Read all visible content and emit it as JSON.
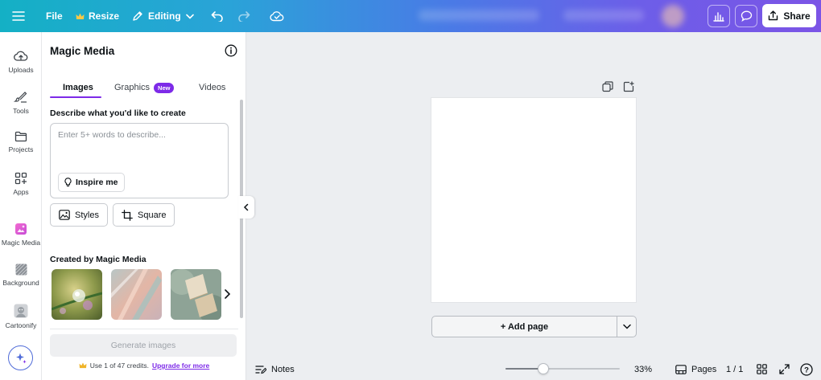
{
  "topbar": {
    "file_label": "File",
    "resize_label": "Resize",
    "editing_label": "Editing",
    "share_label": "Share",
    "icons": [
      "menu-icon",
      "crown-icon",
      "pencil-icon",
      "chevron-down-icon",
      "undo-icon",
      "redo-icon",
      "cloud-check-icon",
      "chart-icon",
      "comment-icon",
      "share-icon"
    ]
  },
  "rail": {
    "items": [
      {
        "label": "Uploads",
        "icon": "upload-cloud-icon"
      },
      {
        "label": "Tools",
        "icon": "tools-icon"
      },
      {
        "label": "Projects",
        "icon": "folder-icon"
      },
      {
        "label": "Apps",
        "icon": "apps-grid-icon"
      },
      {
        "label": "Magic Media",
        "icon": "magic-media-icon"
      },
      {
        "label": "Background",
        "icon": "background-pattern-icon"
      },
      {
        "label": "Cartoonify",
        "icon": "cartoonify-icon"
      }
    ],
    "fab_icon": "sparkle-icon"
  },
  "panel": {
    "title": "Magic Media",
    "tabs": [
      {
        "label": "Images",
        "active": true
      },
      {
        "label": "Graphics",
        "badge": "New"
      },
      {
        "label": "Videos"
      }
    ],
    "describe_label": "Describe what you'd like to create",
    "prompt_placeholder": "Enter 5+ words to describe...",
    "inspire_label": "Inspire me",
    "styles_label": "Styles",
    "aspect_label": "Square",
    "created_label": "Created by Magic Media",
    "generate_label": "Generate images",
    "credits_text": "Use 1 of 47 credits.",
    "upgrade_label": "Upgrade for more"
  },
  "canvas": {
    "add_page_label": "+ Add page"
  },
  "bottombar": {
    "notes_label": "Notes",
    "zoom_level": "33%",
    "zoom_fraction": 0.33,
    "pages_label": "Pages",
    "page_count": "1 / 1",
    "help_label": "?"
  },
  "colors": {
    "accent": "#7d2ae8",
    "badge": "#7d2ae8"
  }
}
